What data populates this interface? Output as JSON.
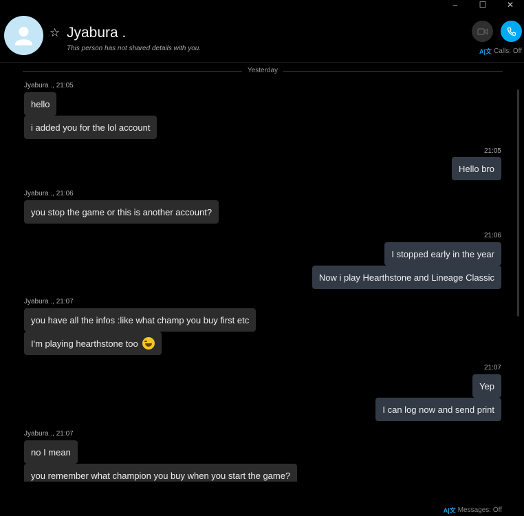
{
  "window": {
    "minimize": "–",
    "maximize": "☐",
    "close": "✕"
  },
  "header": {
    "name": "Jyabura .",
    "subtitle": "This person has not shared details with you.",
    "star_glyph": "☆",
    "calls_status": "Calls: Off",
    "translator_glyph": "A|文"
  },
  "conversation": {
    "day_divider": "Yesterday",
    "groups": [
      {
        "side": "in",
        "meta": "Jyabura ., 21:05",
        "messages": [
          "hello",
          "i added you for the lol account"
        ]
      },
      {
        "side": "out",
        "meta": "21:05",
        "messages": [
          "Hello bro"
        ]
      },
      {
        "side": "in",
        "meta": "Jyabura ., 21:06",
        "messages": [
          "you stop the game or this is another account?"
        ]
      },
      {
        "side": "out",
        "meta": "21:06",
        "messages": [
          "I stopped early in the year",
          "Now i play Hearthstone and Lineage Classic"
        ]
      },
      {
        "side": "in",
        "meta": "Jyabura ., 21:07",
        "messages": [
          "you have all the infos :like what champ you buy first etc",
          "I'm playing hearthstone too"
        ]
      },
      {
        "side": "out",
        "meta": "21:07",
        "messages": [
          "Yep",
          "I can log now and send print"
        ]
      },
      {
        "side": "in",
        "meta": "Jyabura ., 21:07",
        "messages": [
          "no I mean",
          "you remember what champion you buy when you start the game?"
        ]
      }
    ]
  },
  "footer": {
    "messages_status": "Messages: Off",
    "translator_glyph": "A|文"
  },
  "colors": {
    "call_button": "#00a9f2",
    "outgoing_bubble": "#323a46",
    "incoming_bubble": "#2c2c2c",
    "translator": "#22a2e8"
  }
}
